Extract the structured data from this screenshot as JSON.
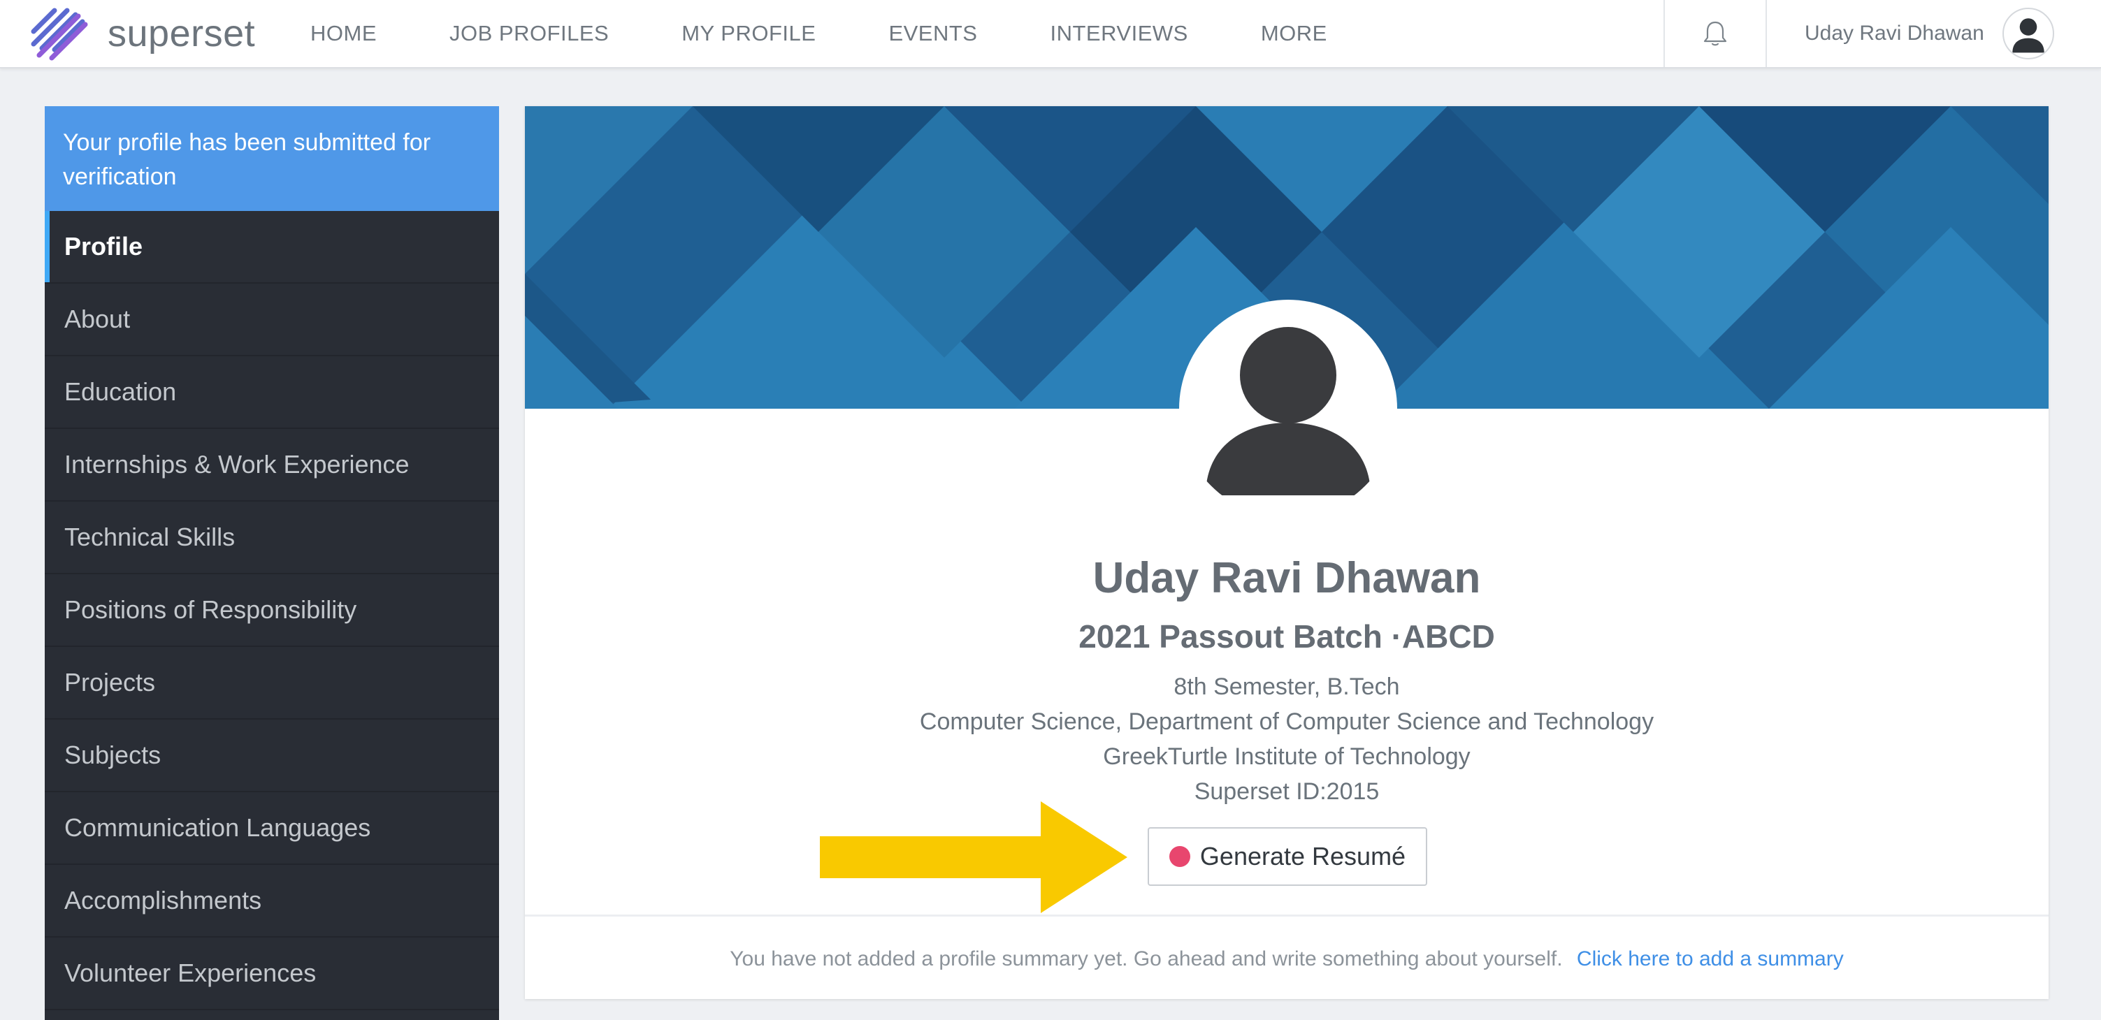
{
  "brand": {
    "name": "superset"
  },
  "nav": {
    "items": [
      "HOME",
      "JOB PROFILES",
      "MY PROFILE",
      "EVENTS",
      "INTERVIEWS",
      "MORE"
    ]
  },
  "user": {
    "name": "Uday Ravi Dhawan"
  },
  "sidebar": {
    "banner": "Your profile has been submitted for verification",
    "items": [
      "Profile",
      "About",
      "Education",
      "Internships & Work Experience",
      "Technical Skills",
      "Positions of Responsibility",
      "Projects",
      "Subjects",
      "Communication Languages",
      "Accomplishments",
      "Volunteer Experiences"
    ],
    "active_item": "Profile"
  },
  "profile": {
    "name": "Uday Ravi Dhawan",
    "batch": "2021 Passout Batch ·ABCD",
    "semester": "8th Semester, B.Tech",
    "department": "Computer Science, Department of Computer Science and Technology",
    "institute": "GreekTurtle Institute of Technology",
    "superset_id": "Superset ID:2015"
  },
  "actions": {
    "generate_resume": "Generate Resumé"
  },
  "summary": {
    "empty_text": "You have not added a profile summary yet. Go ahead and write something about yourself.",
    "link_text": "Click here to add a summary"
  },
  "colors": {
    "banner": "#4f98e8",
    "sidebar": "#292d35",
    "active_indicator": "#3fa9f5",
    "resume_dot": "#e8466e",
    "arrow": "#f9c900",
    "link": "#3f8fe6"
  },
  "icons": {
    "bell": "bell-icon",
    "avatar": "user-avatar-icon",
    "logo": "superset-logo-icon"
  }
}
